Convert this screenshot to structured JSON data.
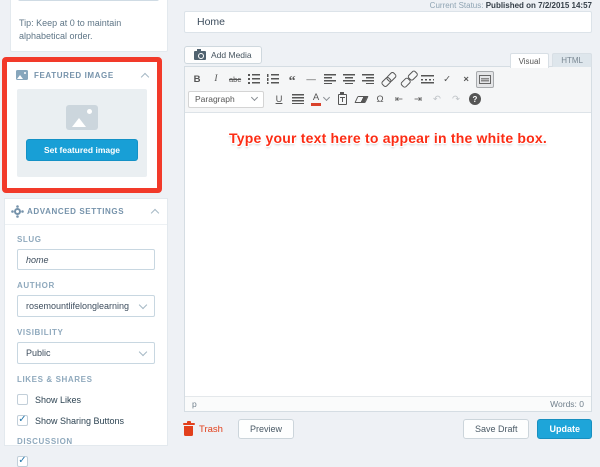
{
  "status_bar": {
    "label": "Current Status:",
    "value": "Published on 7/2/2015 14:57"
  },
  "sidebar": {
    "tip": "Tip: Keep at 0 to maintain alphabetical order.",
    "featured_image": {
      "title": "FEATURED IMAGE",
      "set_button": "Set featured image"
    },
    "advanced": {
      "title": "ADVANCED SETTINGS",
      "slug_label": "SLUG",
      "slug_value": "home",
      "author_label": "AUTHOR",
      "author_value": "rosemountlifelonglearning",
      "visibility_label": "VISIBILITY",
      "visibility_value": "Public",
      "likes_shares_label": "LIKES & SHARES",
      "show_likes_label": "Show Likes",
      "show_likes_checked": false,
      "show_sharing_label": "Show Sharing Buttons",
      "show_sharing_checked": true,
      "discussion_label": "DISCUSSION"
    }
  },
  "editor": {
    "title_value": "Home",
    "add_media_label": "Add Media",
    "tabs": {
      "visual": "Visual",
      "html": "HTML"
    },
    "toolbar": {
      "bold": "B",
      "italic": "I",
      "strike": "abc",
      "quote": "“",
      "hr": "—",
      "spellcheck": "✓",
      "fullscreen": "×",
      "paragraph": "Paragraph",
      "underline": "U",
      "forecolor": "A",
      "omega": "Ω",
      "outdent": "⇤",
      "indent": "⇥",
      "undo": "↶",
      "redo": "↷",
      "help": "?"
    },
    "annotation_text": "Type your text here to appear in the white box.",
    "path": "p",
    "word_count": "Words: 0"
  },
  "actions": {
    "trash": "Trash",
    "preview": "Preview",
    "save_draft": "Save Draft",
    "update": "Update"
  },
  "glyphs": {
    "check": "✓"
  },
  "colors": {
    "accent_blue": "#1ea5d9",
    "annotation_red": "#f23a2a",
    "trash_red": "#e2401c",
    "label_blue_gray": "#8fa9bd"
  },
  "icons": {
    "add_media": "camera-icon",
    "featured_header": "image-icon",
    "featured_placeholder": "image-placeholder-icon",
    "advanced_header": "gear-icon",
    "collapse": "chevron-up-icon",
    "dropdown": "chevron-down-icon",
    "trash": "trash-can-icon",
    "help": "question-circle-icon"
  }
}
